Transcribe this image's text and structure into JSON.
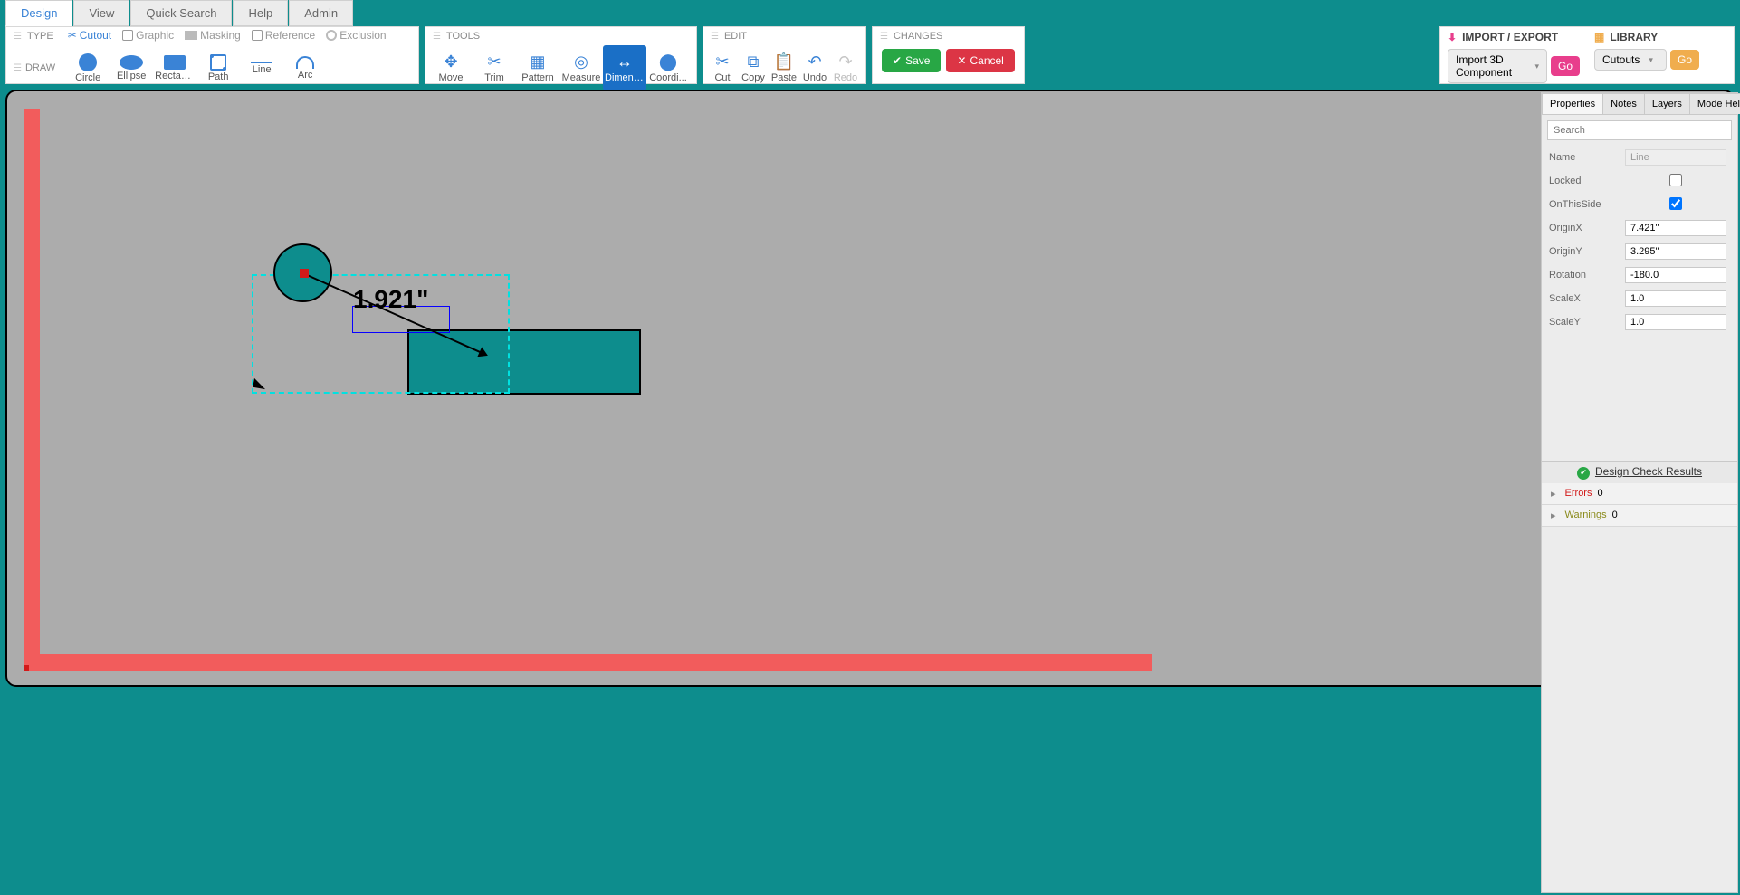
{
  "tabs": [
    "Design",
    "View",
    "Quick Search",
    "Help",
    "Admin"
  ],
  "active_tab": "Design",
  "type": {
    "label": "TYPE",
    "items": [
      "Cutout",
      "Graphic",
      "Masking",
      "Reference",
      "Exclusion"
    ],
    "active": "Cutout"
  },
  "draw": {
    "label": "DRAW",
    "items": [
      "Circle",
      "Ellipse",
      "Rectan...",
      "Path",
      "Line",
      "Arc"
    ]
  },
  "tools": {
    "label": "TOOLS",
    "items": [
      "Move",
      "Trim",
      "Pattern",
      "Measure",
      "Dimens...",
      "Coordi..."
    ],
    "active": "Dimens..."
  },
  "edit": {
    "label": "EDIT",
    "items": [
      "Cut",
      "Copy",
      "Paste",
      "Undo",
      "Redo"
    ],
    "disabled": [
      "Redo"
    ]
  },
  "changes": {
    "label": "CHANGES",
    "save": "Save",
    "cancel": "Cancel"
  },
  "import_export": {
    "label": "IMPORT / EXPORT",
    "dropdown": "Import 3D Component",
    "go": "Go"
  },
  "library": {
    "label": "LIBRARY",
    "dropdown": "Cutouts",
    "go": "Go"
  },
  "canvas": {
    "dimension_text": "1.921\""
  },
  "side": {
    "tabs": [
      "Properties",
      "Notes",
      "Layers",
      "Mode Help"
    ],
    "active": "Properties",
    "search_placeholder": "Search",
    "props": {
      "Name": "Line",
      "Locked": false,
      "OnThisSide": true,
      "OriginX": "7.421\"",
      "OriginY": "3.295\"",
      "Rotation": "-180.0",
      "ScaleX": "1.0",
      "ScaleY": "1.0"
    },
    "check": {
      "title": "Design Check Results",
      "errors_label": "Errors",
      "errors_count": "0",
      "warnings_label": "Warnings",
      "warnings_count": "0"
    }
  }
}
